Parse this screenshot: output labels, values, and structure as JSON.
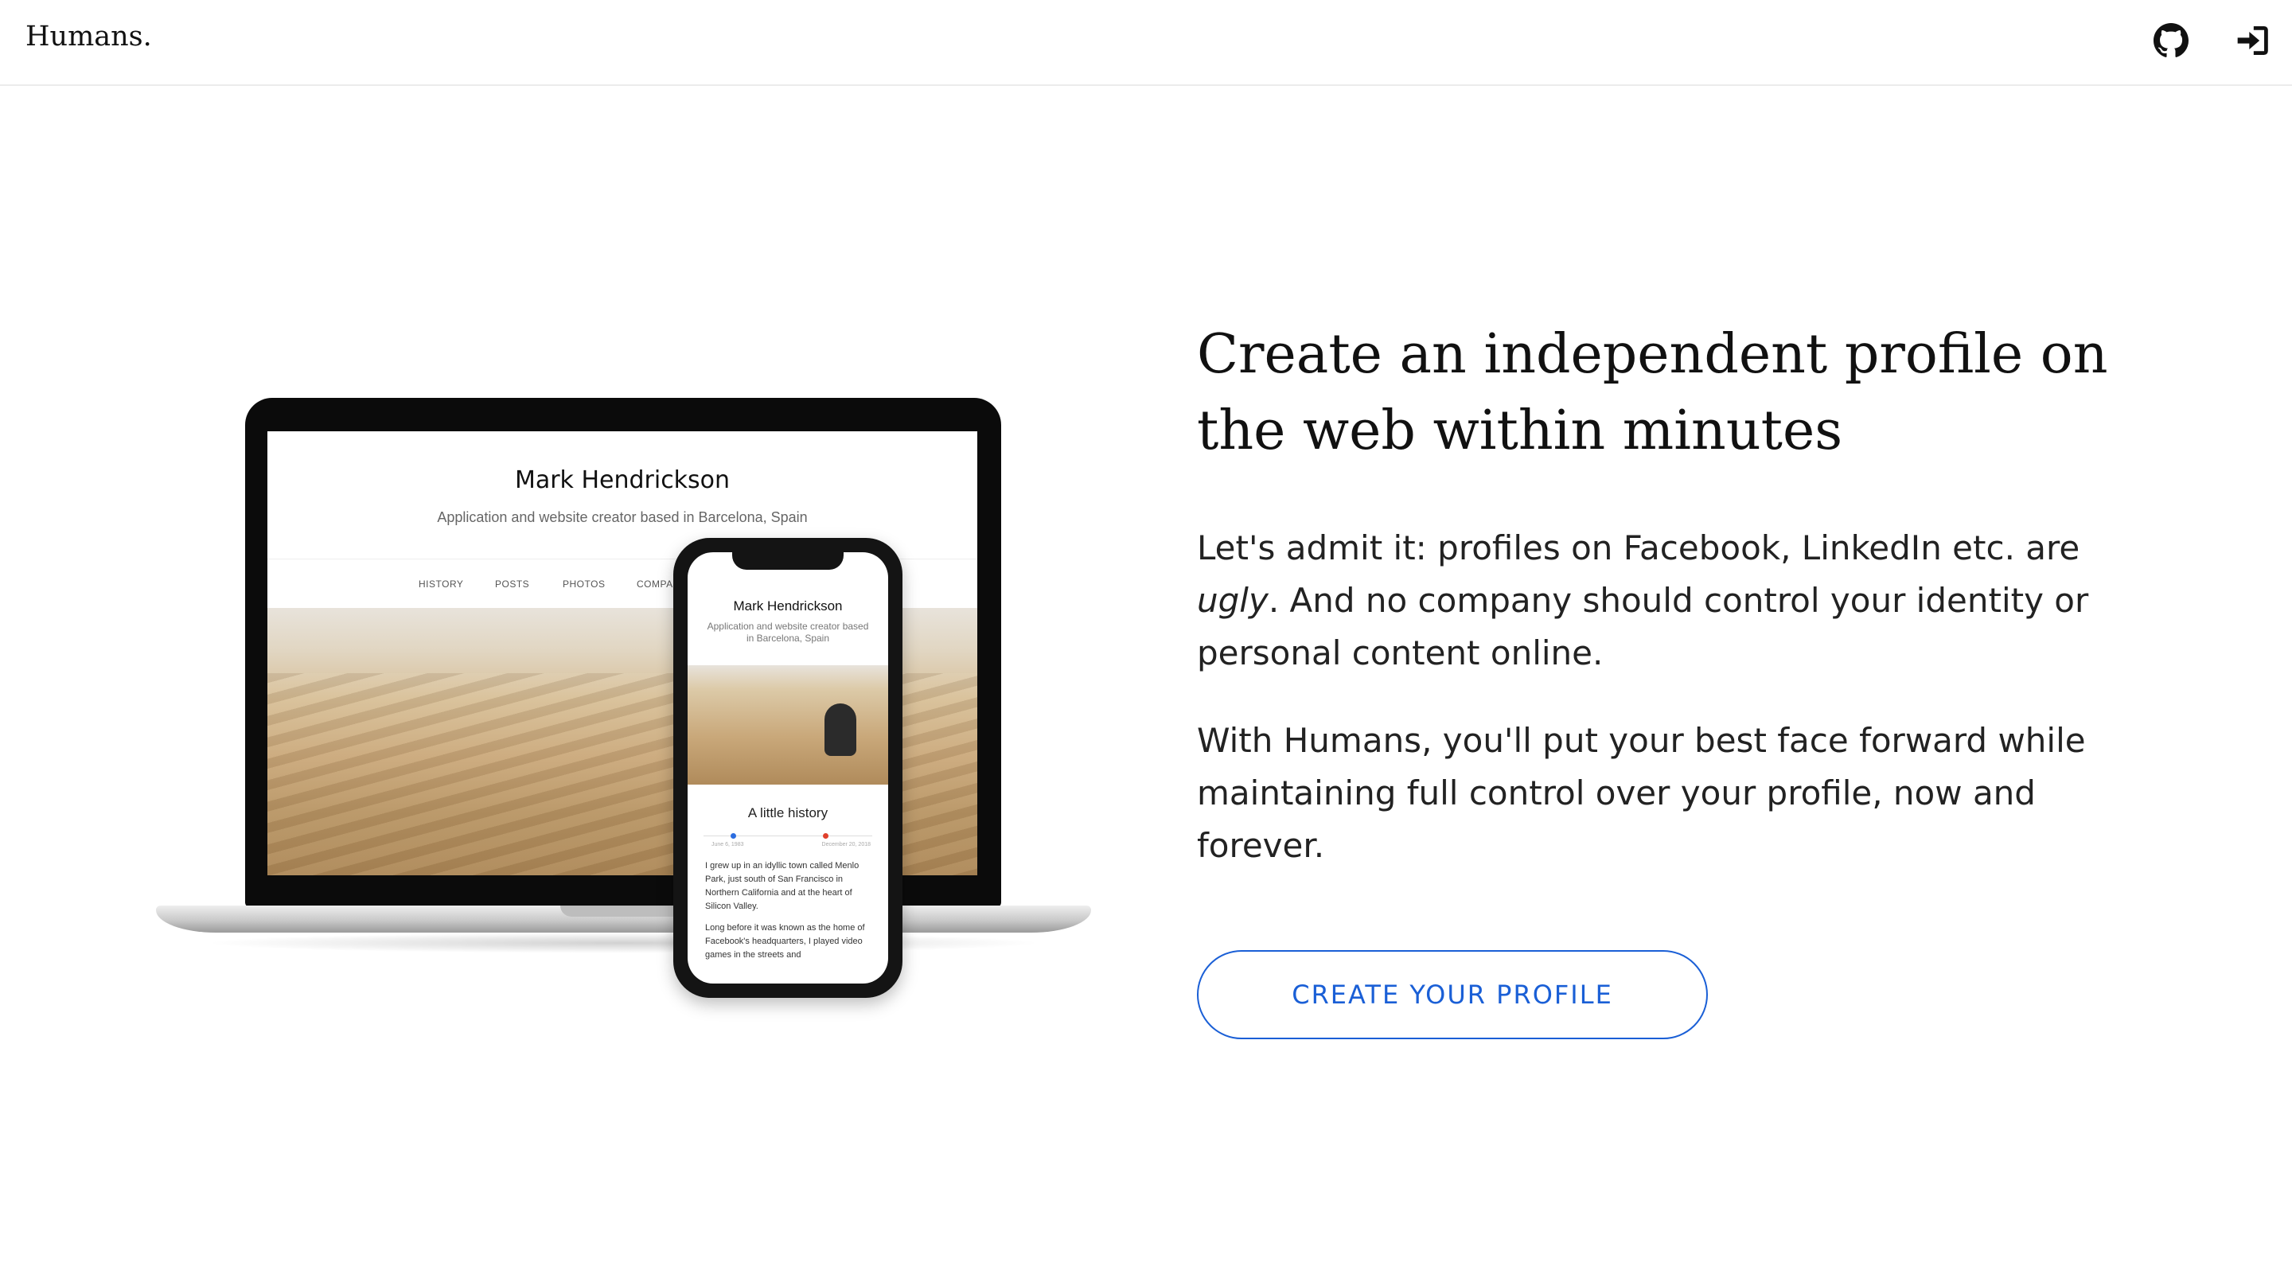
{
  "header": {
    "brand": "Humans.",
    "github_icon": "github-icon",
    "login_icon": "sign-in-icon"
  },
  "hero": {
    "headline": "Create an independent profile on the web within minutes",
    "paragraph1_a": "Let's admit it: profiles on Facebook, LinkedIn etc. are ",
    "paragraph1_em": "ugly",
    "paragraph1_b": ". And no company should control your identity or personal content online.",
    "paragraph2": "With Humans, you'll put your best face forward while maintaining full control over your profile, now and forever.",
    "cta_label": "CREATE YOUR PROFILE"
  },
  "mockup": {
    "laptop": {
      "name": "Mark Hendrickson",
      "subtitle": "Application and website creator based in Barcelona, Spain",
      "nav": [
        "HISTORY",
        "POSTS",
        "PHOTOS",
        "COMPANIES"
      ]
    },
    "phone": {
      "name": "Mark Hendrickson",
      "subtitle": "Application and website creator based in Barcelona, Spain",
      "section_title": "A little history",
      "date_start": "June 6, 1983",
      "date_end": "December 20, 2018",
      "body1": "I grew up in an idyllic town called Menlo Park, just south of San Francisco in Northern California and at the heart of Silicon Valley.",
      "body2": "Long before it was known as the home of Facebook's headquarters, I played video games in the streets and"
    }
  },
  "colors": {
    "accent": "#1a5fd6",
    "text": "#111111",
    "border": "#ececec"
  }
}
